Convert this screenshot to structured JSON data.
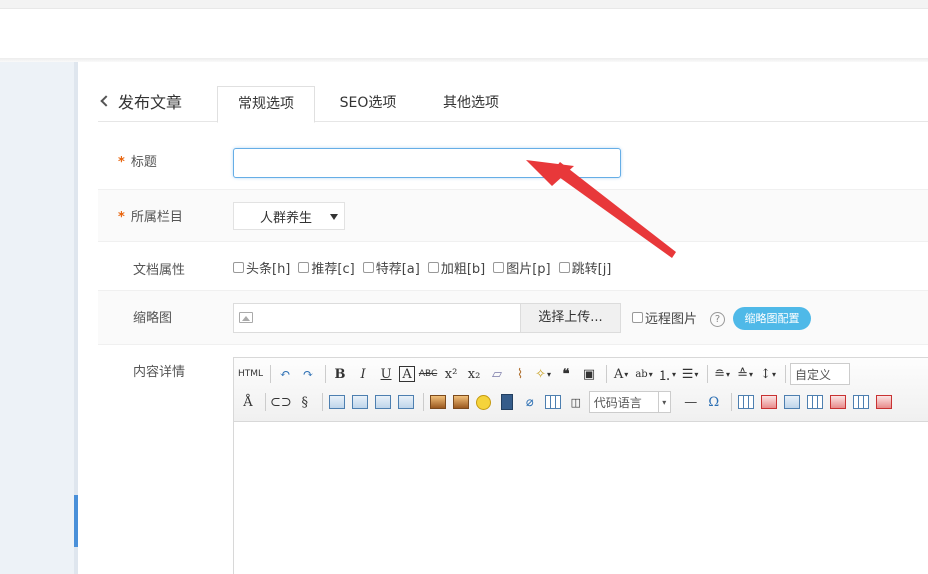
{
  "header": {
    "back_label": "发布文章"
  },
  "tabs": [
    {
      "label": "常规选项",
      "active": true
    },
    {
      "label": "SEO选项",
      "active": false
    },
    {
      "label": "其他选项",
      "active": false
    }
  ],
  "form": {
    "title": {
      "label": "标题",
      "required": "*",
      "value": ""
    },
    "category": {
      "label": "所属栏目",
      "required": "*",
      "value": "人群养生"
    },
    "attributes": {
      "label": "文档属性",
      "options": [
        "头条[h]",
        "推荐[c]",
        "特荐[a]",
        "加粗[b]",
        "图片[p]",
        "跳转[j]"
      ]
    },
    "thumbnail": {
      "label": "缩略图",
      "upload_label": "选择上传...",
      "remote_label": "远程图片",
      "help": "?",
      "config_label": "缩略图配置"
    },
    "content": {
      "label": "内容详情"
    }
  },
  "editor": {
    "html_label": "HTML",
    "code_language": "代码语言",
    "custom_label": "自定义",
    "omega": "Ω"
  },
  "colors": {
    "accent": "#4fb9e8",
    "required": "#e8620a",
    "arrow": "#e8383a",
    "sidebar_active": "#4a90d9"
  }
}
